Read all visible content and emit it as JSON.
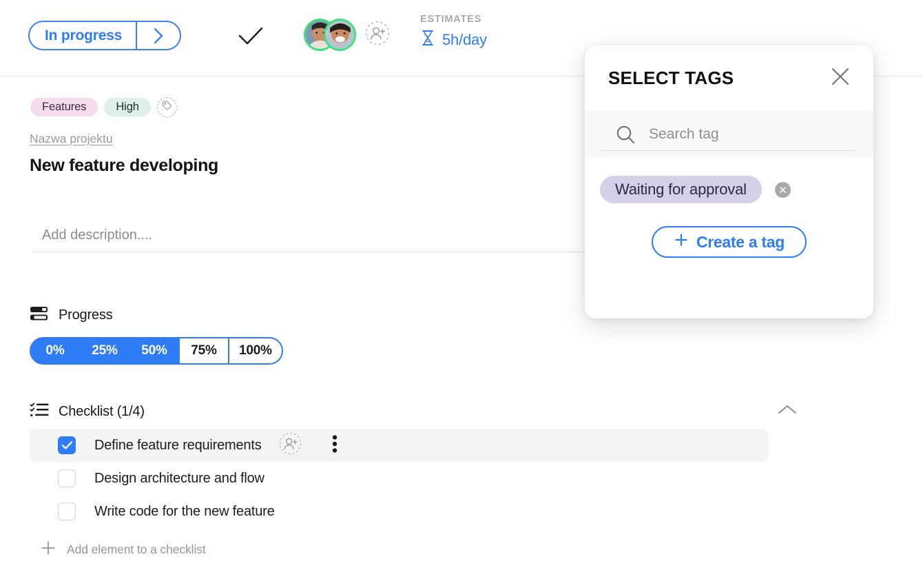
{
  "topbar": {
    "status_label": "In progress",
    "status_chevron_icon": "chevron-right-icon",
    "complete_icon": "checkmark-icon",
    "assignees": [
      {
        "name": "avatar-1",
        "status_color": "#3ee07f"
      },
      {
        "name": "avatar-2",
        "status_color": "#3ee07f"
      }
    ],
    "add_assignee_icon": "person-plus-icon",
    "estimates_label": "ESTIMATES",
    "estimates_icon": "hourglass-icon",
    "estimates_value": "5h/day"
  },
  "tags": {
    "items": [
      {
        "label": "Features",
        "bg": "#f6dcec",
        "fg": "#3e2a46"
      },
      {
        "label": "High",
        "bg": "#dcefe9",
        "fg": "#22312c"
      }
    ],
    "add_icon": "tag-icon"
  },
  "task": {
    "project_link": "Nazwa projektu",
    "title": "New feature developing",
    "description_placeholder": "Add description....",
    "description_value": ""
  },
  "progress": {
    "icon": "progress-bars-icon",
    "label": "Progress",
    "options": [
      {
        "label": "0%",
        "selected": true
      },
      {
        "label": "25%",
        "selected": true
      },
      {
        "label": "50%",
        "selected": true
      },
      {
        "label": "75%",
        "selected": false
      },
      {
        "label": "100%",
        "selected": false
      }
    ],
    "selected_value": "50%",
    "accent_color": "#2f7df6"
  },
  "checklist": {
    "icon": "checklist-icon",
    "label": "Checklist (1/4)",
    "collapse_icon": "chevron-up-icon",
    "items": [
      {
        "label": "Define feature requirements",
        "checked": true,
        "highlighted": true,
        "assign_icon": "person-plus-icon",
        "more_icon": "three-dots-vertical-icon"
      },
      {
        "label": "Design architecture and flow",
        "checked": false,
        "highlighted": false
      },
      {
        "label": "Write code for the new feature",
        "checked": false,
        "highlighted": false
      }
    ],
    "add_icon": "plus-icon",
    "add_label": "Add element to a checklist"
  },
  "modal": {
    "title": "SELECT TAGS",
    "close_icon": "close-icon",
    "search_icon": "search-icon",
    "search_placeholder": "Search tag",
    "search_value": "",
    "tag_chips": [
      {
        "label": "Waiting for approval",
        "bg": "#d5cfe8",
        "fg": "#2b2b4a",
        "remove_icon": "close-circle-icon"
      }
    ],
    "create_icon": "plus-icon",
    "create_label": "Create a tag"
  }
}
